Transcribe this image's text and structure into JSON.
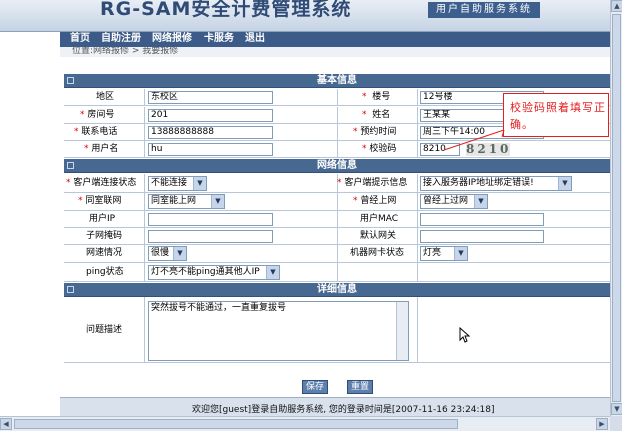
{
  "banner": {
    "title": "RG-SAM安全计费管理系统",
    "subtitle": "用户自助服务系统"
  },
  "nav": {
    "items": [
      "首页",
      "自助注册",
      "网络报修",
      "卡服务",
      "退出"
    ]
  },
  "breadcrumb": "位置:网络报修 > 我要报修",
  "sections": {
    "basic": "基本信息",
    "network": "网络信息",
    "detail": "详细信息"
  },
  "basic": {
    "district_label": "地区",
    "district_value": "东校区",
    "building_label": "楼号",
    "building_value": "12号楼",
    "room_label": "房间号",
    "room_value": "201",
    "name_label": "姓名",
    "name_value": "王某某",
    "phone_label": "联系电话",
    "phone_value": "13888888888",
    "appointment_label": "预约时间",
    "appointment_value": "周三下午14:00",
    "username_label": "用户名",
    "username_value": "hu",
    "captcha_label": "校验码",
    "captcha_value": "8210",
    "captcha_image_text": "8210"
  },
  "network": {
    "client_conn_label": "客户端连接状态",
    "client_conn_value": "不能连接",
    "client_msg_label": "客户端提示信息",
    "client_msg_value": "接入服务器IP地址绑定错误!",
    "same_room_label": "同室联网",
    "same_room_value": "同室能上网",
    "ever_online_label": "曾经上网",
    "ever_online_value": "曾经上过网",
    "user_ip_label": "用户IP",
    "user_ip_value": "",
    "user_mac_label": "用户MAC",
    "user_mac_value": "",
    "subnet_label": "子网掩码",
    "subnet_value": "",
    "gateway_label": "默认网关",
    "gateway_value": "",
    "speed_label": "网速情况",
    "speed_value": "很慢",
    "nic_label": "机器网卡状态",
    "nic_value": "灯亮",
    "ping_label": "ping状态",
    "ping_value": "灯不亮不能ping通其他人IP"
  },
  "detail": {
    "problem_label": "问题描述",
    "problem_value": "突然拔号不能通过，一直重复拔号"
  },
  "buttons": {
    "save": "保存",
    "reset": "重置"
  },
  "footer": "欢迎您[guest]登录自助服务系统, 您的登录时间是[2007-11-16 23:24:18]",
  "callout": "校验码照着填写正确。",
  "required_mark": "*",
  "colors": {
    "section_header": "#476891",
    "nav": "#3c5b88",
    "callout": "#e32020"
  }
}
